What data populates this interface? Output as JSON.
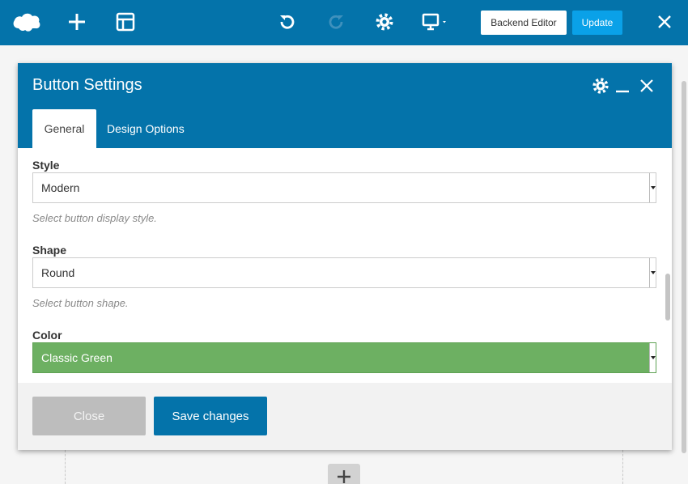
{
  "toolbar": {
    "icons": [
      "logo-cloud-icon",
      "add-element-icon",
      "templates-icon",
      "undo-icon",
      "redo-icon",
      "settings-gear-icon",
      "responsive-monitor-icon",
      "close-icon"
    ],
    "backend_editor_label": "Backend Editor",
    "update_label": "Update"
  },
  "modal": {
    "title": "Button Settings",
    "tabs": [
      {
        "label": "General",
        "active": true
      },
      {
        "label": "Design Options",
        "active": false
      }
    ],
    "fields": [
      {
        "label": "Style",
        "value": "Modern",
        "hint": "Select button display style."
      },
      {
        "label": "Shape",
        "value": "Round",
        "hint": "Select button shape."
      },
      {
        "label": "Color",
        "value": "Classic Green"
      }
    ],
    "close_label": "Close",
    "save_label": "Save changes"
  },
  "colors": {
    "brand_blue": "#0473aa",
    "update_blue": "#0aa1e8",
    "classic_green": "#6db062",
    "close_gray": "#bdbdbd"
  }
}
